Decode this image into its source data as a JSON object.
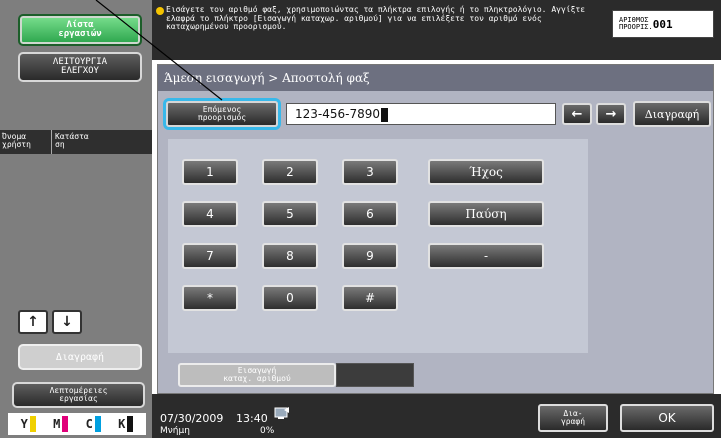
{
  "left": {
    "job_list": "Λίστα\nεργασιών",
    "check_function": "ΛΕΙΤΟΥΡΓΙΑ\nΕΛΕΓΧΟΥ",
    "user_name_header": "Όνομα\nχρήστη",
    "status_header": "Κατάστα\nση",
    "delete": "Διαγραφή",
    "job_details": "Λεπτομέρειες\nεργασίας",
    "toner": [
      {
        "letter": "Y",
        "color": "#f0d000"
      },
      {
        "letter": "M",
        "color": "#e0007a"
      },
      {
        "letter": "C",
        "color": "#00a0e0"
      },
      {
        "letter": "K",
        "color": "#111111"
      }
    ]
  },
  "top": {
    "message": "Εισάγετε τον αριθμό φαξ, χρησιμοποιώντας τα πλήκτρα επιλογής ή το πληκτρολόγιο. Αγγίξτε ελαφρά το πλήκτρο [Εισαγωγή καταχωρ. αριθμού] για να επιλέξετε τον αριθμό ενός καταχωρημένου προορισμού.",
    "counter_label": "ΑΡΙΘΜΟΣ\nΠΡΟΟΡΙΣ.",
    "counter_value": "001"
  },
  "main": {
    "breadcrumb": "Άμεση εισαγωγή > Αποστολή φαξ",
    "next_destination": "Επόμενος\nπροορισμός",
    "fax_number": "123-456-7890",
    "left_arrow": "←",
    "right_arrow": "→",
    "clear": "Διαγραφή",
    "keys": {
      "k1": "1",
      "k2": "2",
      "k3": "3",
      "k4": "4",
      "k5": "5",
      "k6": "6",
      "k7": "7",
      "k8": "8",
      "k9": "9",
      "kstar": "*",
      "k0": "0",
      "khash": "#",
      "tone": "Ήχος",
      "pause": "Παύση",
      "dash": "-"
    },
    "saved_number": "Εισαγωγή\nκαταχ. αριθμού"
  },
  "bottom": {
    "date": "07/30/2009",
    "time": "13:40",
    "memory_label": "Μνήμη",
    "memory_value": "0%",
    "scan": "Δια-\nγραφή",
    "ok": "OK"
  }
}
